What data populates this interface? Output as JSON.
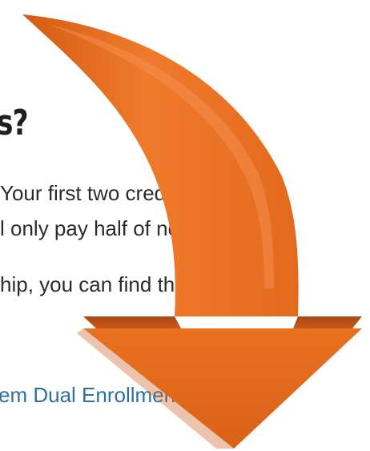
{
  "content": {
    "heading": "s?",
    "line1": "Your first two credits (up to 6",
    "line2": "l only pay half of normal tuition",
    "line3": "hip, you can find the Stewardshi",
    "link": "em Dual Enrollment webpage"
  },
  "overlay": {
    "icon": "down-arrow-icon",
    "color": "#e2681a"
  }
}
